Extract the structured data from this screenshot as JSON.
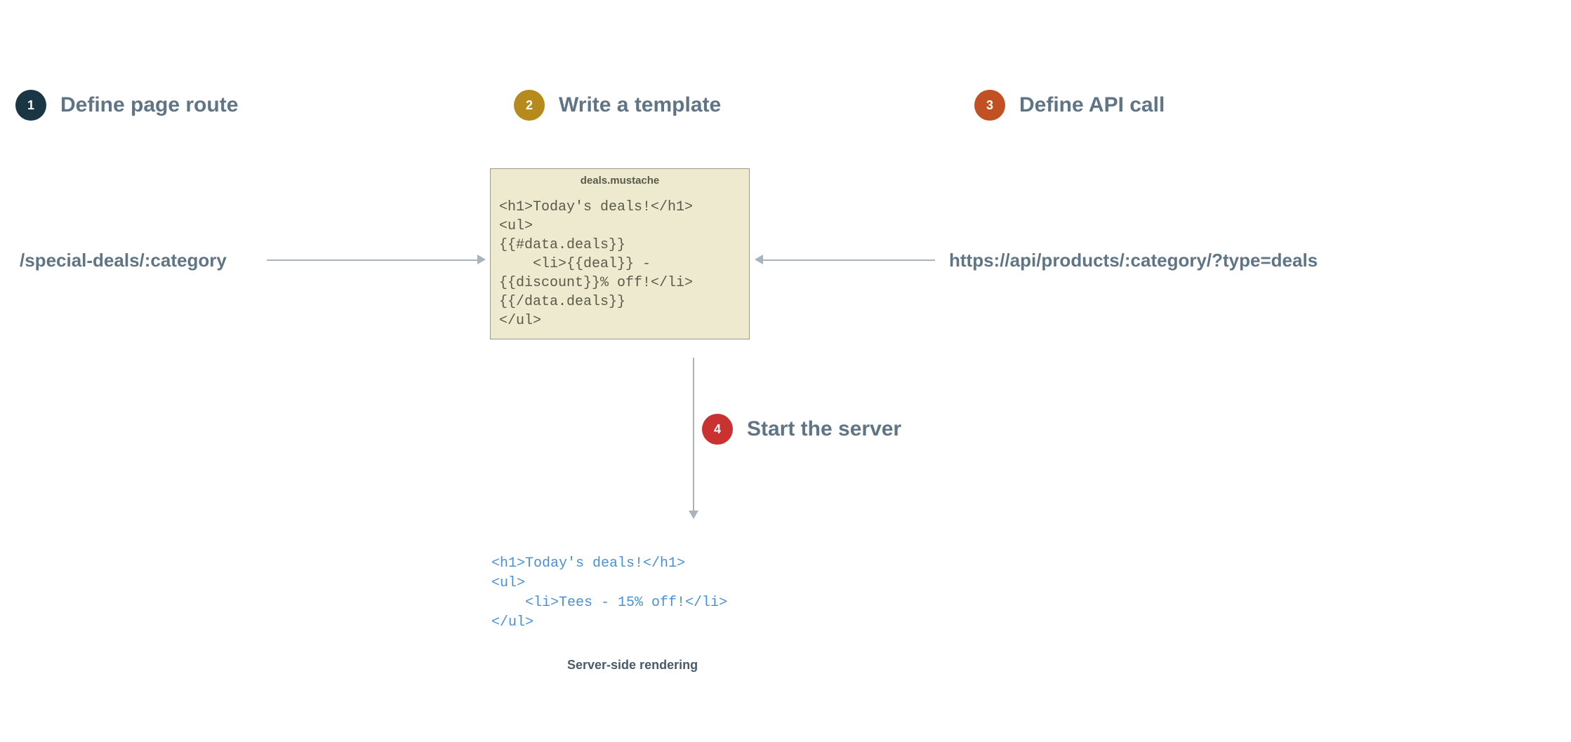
{
  "steps": [
    {
      "num": "1",
      "title": "Define page route"
    },
    {
      "num": "2",
      "title": "Write a template"
    },
    {
      "num": "3",
      "title": "Define API call"
    },
    {
      "num": "4",
      "title": "Start the server"
    }
  ],
  "route_text": "/special-deals/:category",
  "api_text": "https://api/products/:category/?type=deals",
  "template": {
    "filename": "deals.mustache",
    "code": "<h1>Today's deals!</h1>\n<ul>\n{{#data.deals}}\n    <li>{{deal}} - \n{{discount}}% off!</li>\n{{/data.deals}}\n</ul>"
  },
  "output_code": "<h1>Today's deals!</h1>\n<ul>\n    <li>Tees - 15% off!</li>\n</ul>",
  "caption": "Server-side rendering"
}
